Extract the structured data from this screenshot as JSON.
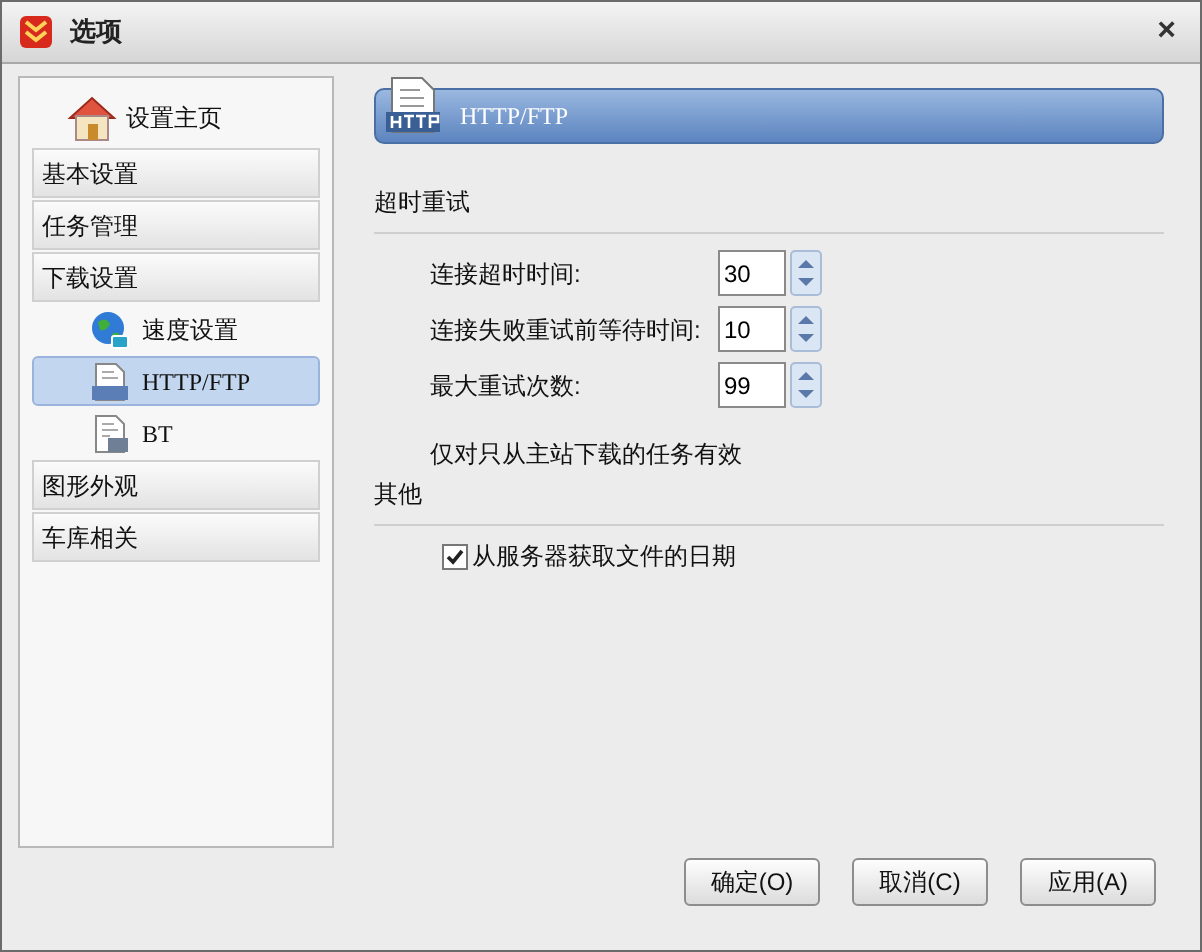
{
  "window": {
    "title": "选项",
    "close": "×"
  },
  "sidebar": {
    "items": [
      {
        "kind": "home",
        "label": "设置主页",
        "selected": false
      },
      {
        "kind": "section",
        "label": "基本设置",
        "selected": false
      },
      {
        "kind": "section",
        "label": "任务管理",
        "selected": false
      },
      {
        "kind": "section",
        "label": "下载设置",
        "selected": false
      },
      {
        "kind": "globe",
        "label": "速度设置",
        "selected": false
      },
      {
        "kind": "http",
        "label": "HTTP/FTP",
        "selected": true
      },
      {
        "kind": "bt",
        "label": "BT",
        "selected": false
      },
      {
        "kind": "section",
        "label": "图形外观",
        "selected": false
      },
      {
        "kind": "section",
        "label": "车库相关",
        "selected": false
      }
    ]
  },
  "header": {
    "title": "HTTP/FTP"
  },
  "timeout_group": {
    "title": "超时重试",
    "fields": [
      {
        "label": "连接超时时间:",
        "value": "30"
      },
      {
        "label": "连接失败重试前等待时间:",
        "value": "10"
      },
      {
        "label": "最大重试次数:",
        "value": "99"
      }
    ],
    "note": "仅对只从主站下载的任务有效"
  },
  "other_group": {
    "title": "其他",
    "options": [
      {
        "label": "从服务器获取文件的日期",
        "checked": true
      }
    ]
  },
  "buttons": [
    "确定(O)",
    "取消(C)",
    "应用(A)"
  ]
}
